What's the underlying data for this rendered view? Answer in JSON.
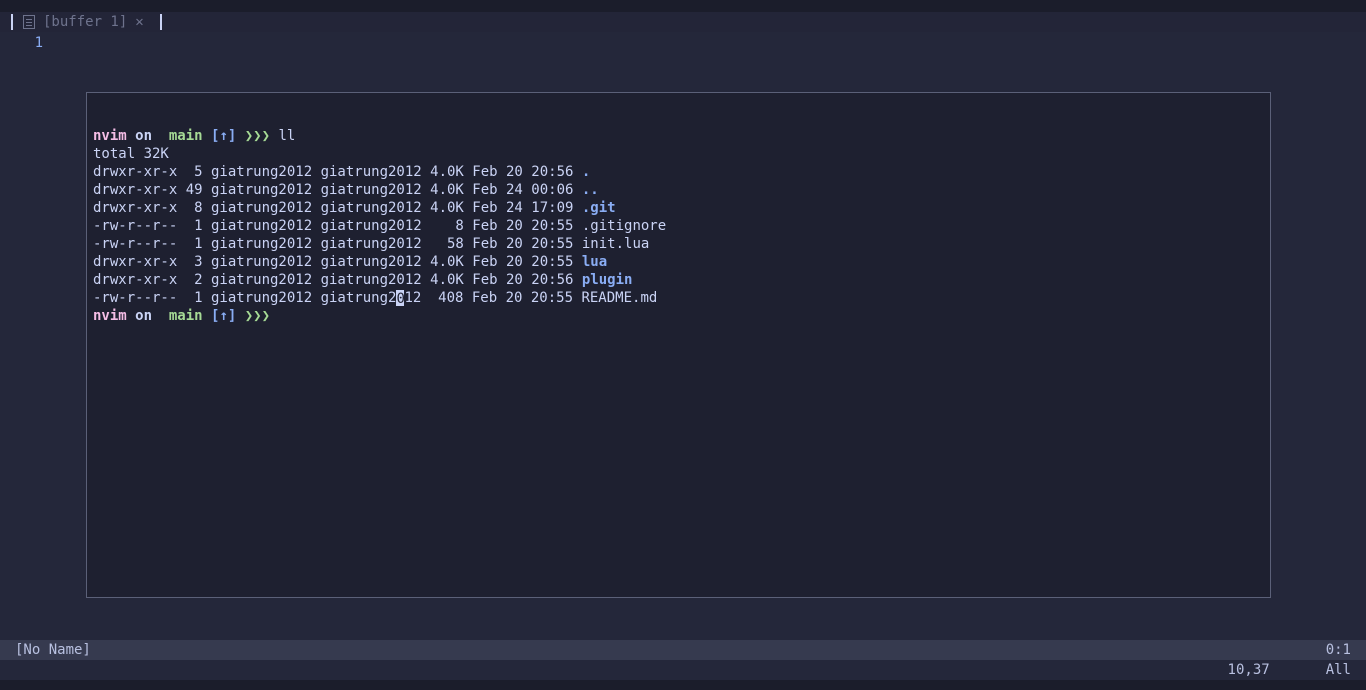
{
  "tab": {
    "label": "[buffer 1]",
    "close": "✕"
  },
  "gutter": {
    "line1": "1"
  },
  "prompt": {
    "dir": "nvim",
    "on": " on ",
    "branchsym": "",
    "branch": " main ",
    "status": "[↑] ",
    "arrows": "❯❯❯"
  },
  "command": " ll",
  "listing": {
    "total": "total 32K",
    "rows": [
      {
        "pre": "drwxr-xr-x  5 giatrung2012 giatrung2012 4.0K Feb 20 20:56 ",
        "name": ".",
        "cls": "dirlink"
      },
      {
        "pre": "drwxr-xr-x 49 giatrung2012 giatrung2012 4.0K Feb 24 00:06 ",
        "name": "..",
        "cls": "dirlink"
      },
      {
        "pre": "drwxr-xr-x  8 giatrung2012 giatrung2012 4.0K Feb 24 17:09 ",
        "name": ".git",
        "cls": "dirlink"
      },
      {
        "pre": "-rw-r--r--  1 giatrung2012 giatrung2012    8 Feb 20 20:55 ",
        "name": ".gitignore",
        "cls": ""
      },
      {
        "pre": "-rw-r--r--  1 giatrung2012 giatrung2012   58 Feb 20 20:55 ",
        "name": "init.lua",
        "cls": ""
      },
      {
        "pre": "drwxr-xr-x  3 giatrung2012 giatrung2012 4.0K Feb 20 20:55 ",
        "name": "lua",
        "cls": "dirlink"
      },
      {
        "pre": "drwxr-xr-x  2 giatrung2012 giatrung2012 4.0K Feb 20 20:56 ",
        "name": "plugin",
        "cls": "dirlink"
      }
    ],
    "lastrow": {
      "preA": "-rw-r--r--  1 giatrung2012 giatrung2",
      "cursor_char": "0",
      "preB": "12  408 Feb 20 20:55 ",
      "name": "README.md"
    }
  },
  "status": {
    "left": "[No Name]",
    "right": "0:1"
  },
  "cmdline": {
    "pos": "10,37",
    "scroll": "All"
  }
}
